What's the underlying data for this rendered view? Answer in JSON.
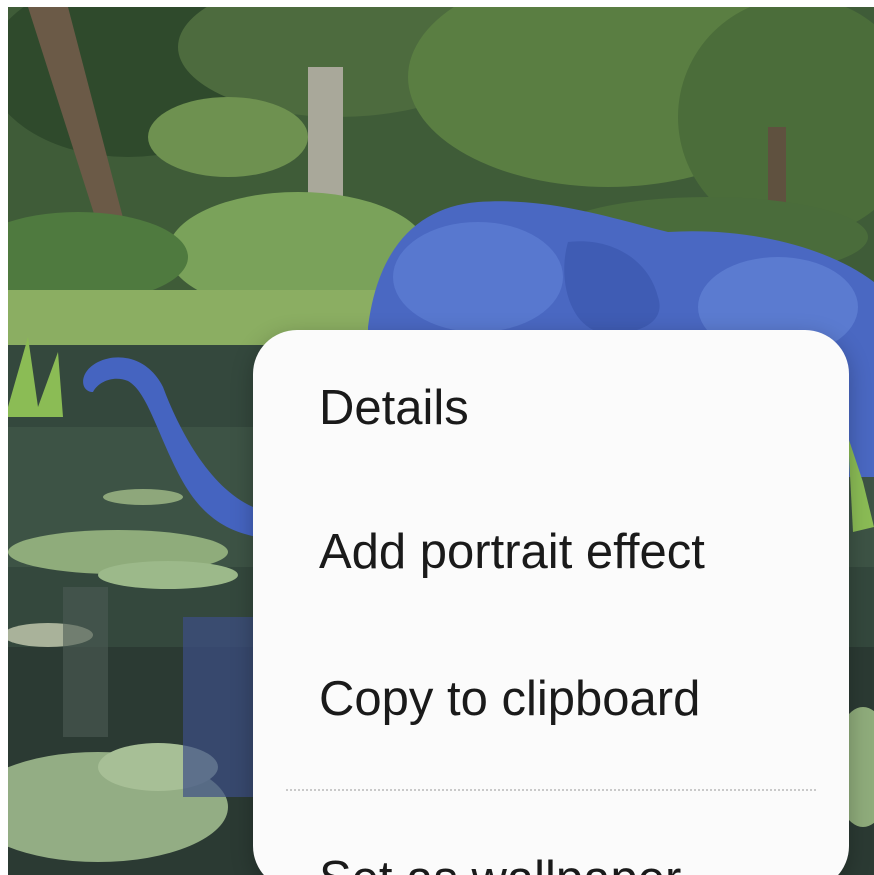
{
  "context_menu": {
    "items": [
      {
        "label": "Details"
      },
      {
        "label": "Add portrait effect"
      },
      {
        "label": "Copy to clipboard"
      },
      {
        "label": "Set as wallpaper"
      }
    ]
  }
}
